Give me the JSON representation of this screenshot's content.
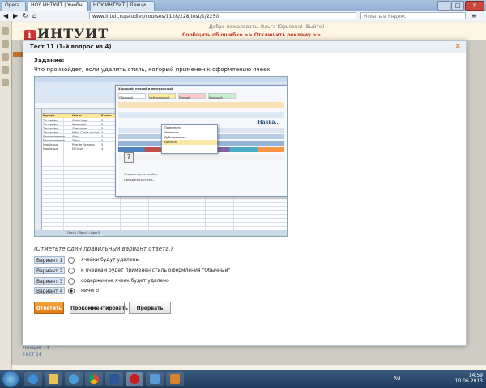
{
  "browser": {
    "tabs": [
      {
        "label": "Opera"
      },
      {
        "label": "НОУ ИНТУИТ | Учебн..."
      },
      {
        "label": "НОУ ИНТУИТ | Лекци..."
      }
    ],
    "url": "www.intuit.ru/studies/courses/1128/228/test/1/2250",
    "search_placeholder": "Искать в Яндекс",
    "window_buttons": [
      "–",
      "□",
      "✕"
    ]
  },
  "site": {
    "logo_text": "ИНТУИТ",
    "greeting": "Добро пожаловать, Ольга Юрьевна! (Выйти)",
    "report_links": "Сообщить об ошибке >>   Отключить рекламу >>",
    "bg_links": [
      "Лекция 14",
      "Тест 14"
    ]
  },
  "modal": {
    "title": "Тест 11 (1-й вопрос из 4)",
    "close": "✕",
    "question_label": "Задание:",
    "question_text": "Что произойдет, если удалить стиль, который применен к оформлению ячеек",
    "hint": "(Отметьте один правильный вариант ответа.)",
    "answers": [
      {
        "badge": "Вариант 1",
        "text": "ячейки будут удалены",
        "selected": false
      },
      {
        "badge": "Вариант 2",
        "text": "к ячейкам будет применен стиль оформления \"Обычный\"",
        "selected": false
      },
      {
        "badge": "Вариант 3",
        "text": "содержимое ячеек будет удалено",
        "selected": false
      },
      {
        "badge": "Вариант 4",
        "text": "ничего",
        "selected": true
      }
    ],
    "buttons": {
      "submit": "Ответить",
      "comment": "Прокомментировать",
      "abort": "Прервать"
    }
  },
  "excel": {
    "headers": [
      "Курорт",
      "Отель",
      "Колич"
    ],
    "rows": [
      [
        "Тенерифе",
        "Costa Lago",
        "5"
      ],
      [
        "Тенерифе",
        "Anaynaga",
        "3"
      ],
      [
        "Тенерифе",
        "Ламантин",
        "3"
      ],
      [
        "Тенерифе",
        "Meliá Costa del Sol",
        "4"
      ],
      [
        "Бенальмадена",
        "Alay",
        "3"
      ],
      [
        "Бенальмадена",
        "Triton",
        "4"
      ],
      [
        "Марбелья",
        "Puente Romano",
        "5"
      ],
      [
        "Марбелья",
        "El Oasis",
        "4"
      ]
    ],
    "panel_title": "Хороший, плохой и нейтральный",
    "panel_styles": [
      "Обычный",
      "Нейтральный",
      "Плохой",
      "Хороший"
    ],
    "panel_big": "Назва...",
    "context_menu": [
      "Применить",
      "Изменить...",
      "Дублировать...",
      "Удалить"
    ],
    "bottom_menu": [
      "Создать стиль ячейки...",
      "Объединить стили..."
    ],
    "sheet_tabs": "Лист1 / Лист2 / Лист3",
    "qmark": "?"
  },
  "taskbar": {
    "lang": "RU",
    "time": "14:59",
    "date": "10.06.2013"
  }
}
